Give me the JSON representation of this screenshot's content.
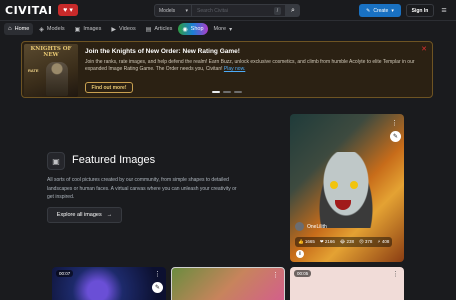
{
  "header": {
    "logo": "CIVITAI",
    "heart_icon": "heart-icon",
    "models_select": "Models",
    "search_placeholder": "Search Civitai",
    "slash_key": "/",
    "create_label": "Create",
    "signin_label": "Sign In"
  },
  "nav": {
    "items": [
      {
        "label": "Home",
        "icon": "home-icon"
      },
      {
        "label": "Models",
        "icon": "cube-icon"
      },
      {
        "label": "Images",
        "icon": "photo-icon"
      },
      {
        "label": "Videos",
        "icon": "video-icon"
      },
      {
        "label": "Articles",
        "icon": "article-icon"
      },
      {
        "label": "Shop",
        "icon": "shop-icon"
      },
      {
        "label": "More",
        "icon": "chevron-down-icon"
      }
    ]
  },
  "banner": {
    "image_title": "KNIGHTS OF NEW",
    "image_subtitle": "RATE",
    "title": "Join the Knights of New Order: New Rating Game!",
    "text": "Join the ranks, rate images, and help defend the realm! Earn Buzz, unlock exclusive cosmetics, and climb from humble Acolyte to elite Templar in our expanded Image Rating Game. The Order needs you, Civitan!",
    "link": "Play now.",
    "button": "Find out more!"
  },
  "featured": {
    "title": "Featured Images",
    "description": "All sorts of cool pictures created by our community, from simple shapes to detailed landscapes or human faces. A virtual canvas where you can unleash your creativity or get inspired.",
    "explore_label": "Explore all images"
  },
  "big_card": {
    "username": "OneLilith",
    "reactions": [
      "1665",
      "2166",
      "238",
      "378",
      "408"
    ]
  },
  "bottom_cards": [
    {
      "time": "00:07"
    },
    {
      "time": ""
    },
    {
      "time": "00:05"
    }
  ]
}
